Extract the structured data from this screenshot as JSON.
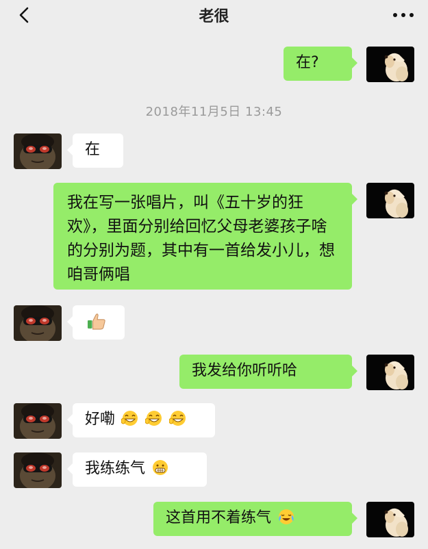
{
  "header": {
    "title": "老很",
    "back_icon": "chevron-left-icon",
    "more_icon": "ellipsis-icon"
  },
  "timestamp": "2018年11月5日 13:45",
  "messages": [
    {
      "side": "outgoing",
      "text": "在?"
    },
    {
      "side": "incoming",
      "text": "在"
    },
    {
      "side": "outgoing",
      "text": "我在写一张唱片，叫《五十岁的狂欢》，里面分别给回忆父母老婆孩子啥的分别为题，其中有一首给发小儿，想咱哥俩唱"
    },
    {
      "side": "incoming",
      "text": "",
      "emoji": "thumbs-up"
    },
    {
      "side": "outgoing",
      "text": "我发给你听听哈"
    },
    {
      "side": "incoming",
      "text": "好嘞",
      "emoji": "grin-laugh x3"
    },
    {
      "side": "incoming",
      "text": "我练练气",
      "emoji": "grimace"
    },
    {
      "side": "outgoing",
      "text": "这首用不着练气",
      "emoji": "laughing-crying"
    }
  ],
  "colors": {
    "background": "#ededed",
    "outgoing_bubble": "#95ec69",
    "incoming_bubble": "#ffffff",
    "timestamp_text": "#9a9a9a"
  }
}
